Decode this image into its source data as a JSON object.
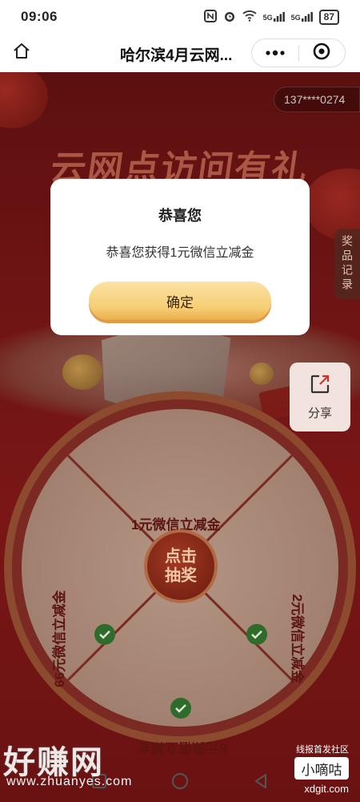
{
  "status_bar": {
    "time": "09:06",
    "signal_1": "5G",
    "signal_2": "5G",
    "battery": "87"
  },
  "nav": {
    "title": "哈尔滨4月云网..."
  },
  "page": {
    "phone_masked": "137****0274",
    "banner_title": "云网点访问有礼",
    "record_tab": "奖品记录",
    "share_label": "分享"
  },
  "wheel": {
    "prizes": {
      "top": "1元微信立减金",
      "right": "2元微信立减金",
      "bottom": "6元微信立减金",
      "left": "66元微信立减金"
    },
    "center_line1": "点击",
    "center_line2": "抽奖"
  },
  "modal": {
    "title": "恭喜您",
    "message": "恭喜您获得1元微信立减金",
    "confirm": "确定"
  },
  "watermark": {
    "left_text": "好赚网",
    "left_url": "www.zhuanyes.com",
    "right_top": "线报首发社区",
    "right_box": "小嘀咕",
    "right_url": "xdgit.com"
  },
  "colors": {
    "page_bg": "#6e1414",
    "modal_button": "#f6cd72",
    "wheel_segment": "#e8d6c6"
  }
}
